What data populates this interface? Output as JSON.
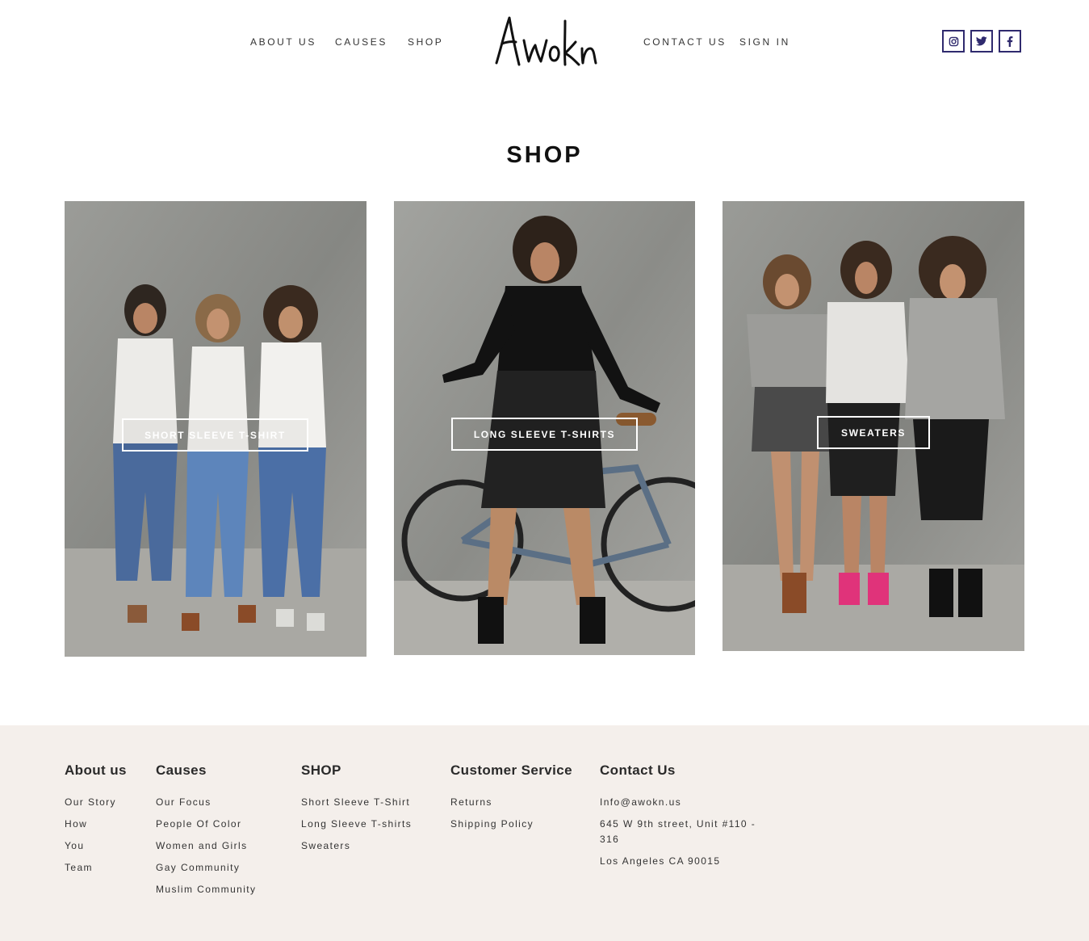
{
  "header": {
    "nav_left": [
      "ABOUT US",
      "CAUSES",
      "SHOP"
    ],
    "nav_right": [
      "CONTACT US",
      "SIGN IN"
    ],
    "logo_text": "Awokn",
    "social": [
      {
        "icon": "instagram-icon"
      },
      {
        "icon": "twitter-icon"
      },
      {
        "icon": "facebook-icon"
      }
    ],
    "accent_color": "#2f2a6e"
  },
  "main": {
    "title": "SHOP",
    "cards": [
      {
        "label": "SHORT SLEEVE T-SHIRT"
      },
      {
        "label": "LONG SLEEVE T-SHIRTS"
      },
      {
        "label": "SWEATERS"
      }
    ]
  },
  "footer": {
    "background": "#f4efeb",
    "columns": [
      {
        "heading": "About us",
        "links": [
          "Our Story",
          "How",
          "You",
          "Team"
        ]
      },
      {
        "heading": "Causes",
        "links": [
          "Our Focus",
          "People Of Color",
          "Women and Girls",
          "Gay Community",
          "Muslim Community"
        ]
      },
      {
        "heading": "SHOP",
        "links": [
          "Short Sleeve T-Shirt",
          "Long Sleeve T-shirts",
          "Sweaters"
        ]
      },
      {
        "heading": "Customer Service",
        "links": [
          "Returns",
          "Shipping Policy"
        ]
      },
      {
        "heading": "Contact Us",
        "links": [
          "Info@awokn.us",
          "645 W 9th street, Unit #110 - 316",
          "Los Angeles CA 90015"
        ]
      }
    ]
  }
}
